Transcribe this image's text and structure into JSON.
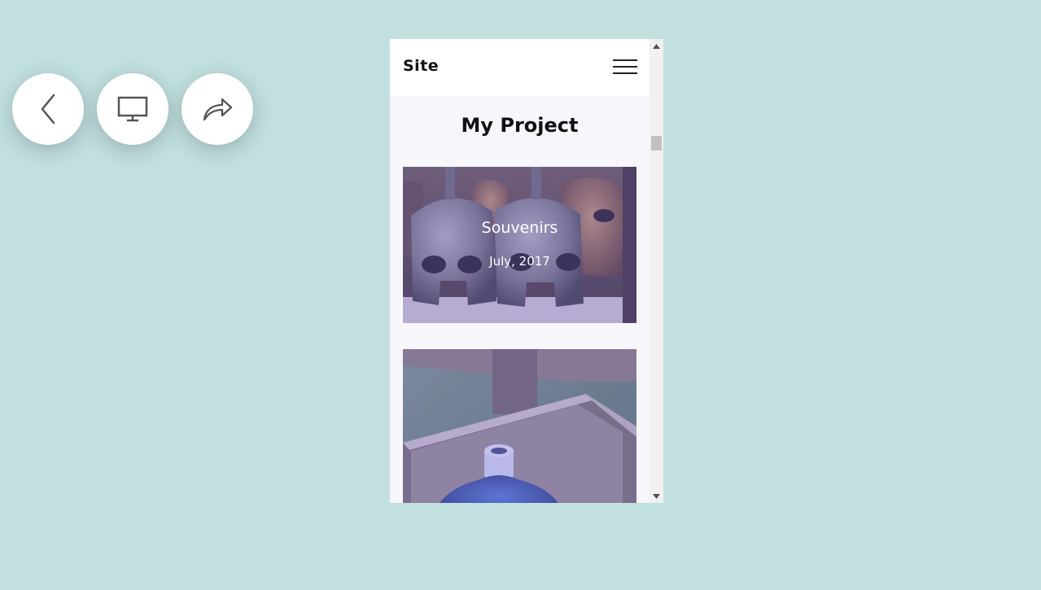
{
  "toolbar": {
    "buttons": [
      {
        "name": "back",
        "icon": "chevron-left-icon"
      },
      {
        "name": "desktop-view",
        "icon": "monitor-icon"
      },
      {
        "name": "share",
        "icon": "share-arrow-icon"
      }
    ]
  },
  "site": {
    "brand": "Site",
    "menu_icon": "hamburger-menu-icon",
    "section_title": "My Project",
    "cards": [
      {
        "title": "Souvenirs",
        "date": "July, 2017",
        "image": "helmets-photo"
      },
      {
        "title": "",
        "date": "",
        "image": "bottle-in-box-photo"
      }
    ]
  },
  "colors": {
    "page_background": "#c2e0e0",
    "card_overlay": "#7864d2",
    "section_background": "#f7f6fb"
  }
}
